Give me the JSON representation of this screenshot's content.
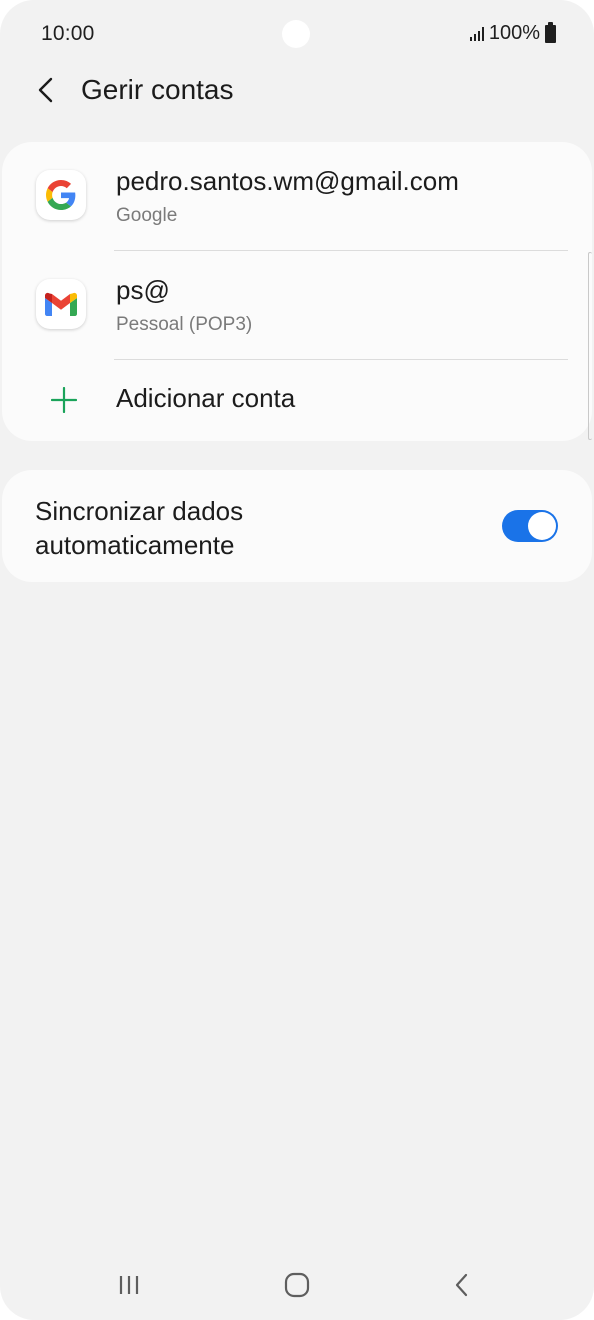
{
  "status_bar": {
    "time": "10:00",
    "battery": "100%"
  },
  "header": {
    "title": "Gerir contas",
    "back_icon": "chevron-left-icon"
  },
  "accounts": [
    {
      "title": "pedro.santos.wm@gmail.com",
      "subtitle": "Google",
      "icon": "google-icon"
    },
    {
      "title": "ps@",
      "subtitle": "Pessoal (POP3)",
      "icon": "gmail-icon"
    }
  ],
  "add_account": {
    "label": "Adicionar conta",
    "icon": "plus-icon",
    "icon_color": "#1aa35a"
  },
  "sync": {
    "label": "Sincronizar dados automaticamente",
    "enabled": true,
    "toggle_color": "#1a73e8"
  },
  "nav_bar": {
    "items": [
      "recents-icon",
      "home-icon",
      "back-icon"
    ]
  }
}
